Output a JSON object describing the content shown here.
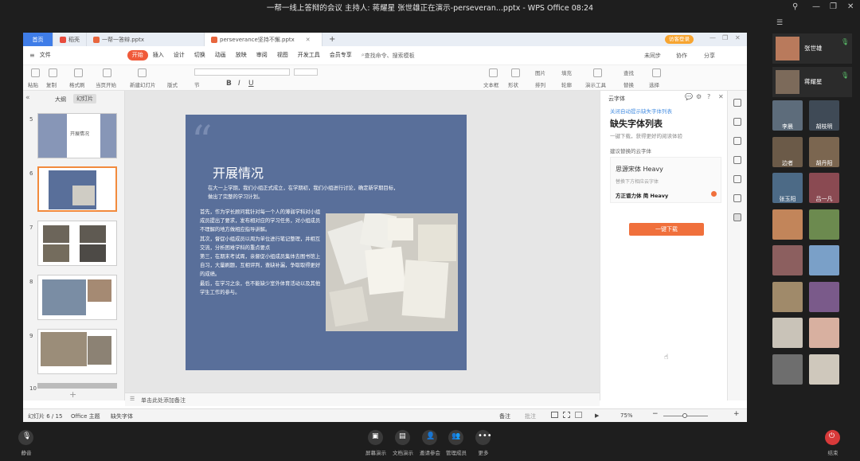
{
  "meeting": {
    "title": "一帮一线上答辩的会议  主持人: 蒋耀星  张世雄正在演示-perseveran...pptx - WPS Office  08:24"
  },
  "wps": {
    "tabs": [
      {
        "label": "首页"
      },
      {
        "label": "稻壳"
      },
      {
        "label": "一帮一答辩.pptx"
      },
      {
        "label": "perseverance坚持不懈.pptx"
      }
    ],
    "login_label": "访客登录",
    "menu": [
      "文件",
      "开始",
      "插入",
      "设计",
      "切换",
      "动画",
      "放映",
      "审阅",
      "视图",
      "开发工具",
      "会员专享"
    ],
    "search_placeholder": "查找命令、搜索模板",
    "right_menu": [
      "未同步",
      "协作",
      "分享"
    ],
    "toolbar_labels": [
      "粘贴",
      "复制",
      "格式刷",
      "当页开始",
      "新建幻灯片",
      "版式",
      "节",
      "文本框",
      "形状",
      "图片",
      "排列",
      "填充",
      "轮廓",
      "演示工具",
      "查找",
      "替换",
      "选择"
    ],
    "pane_tabs": [
      "大纲",
      "幻灯片"
    ],
    "slides": [
      {
        "num": "5",
        "label": "开展情况"
      },
      {
        "num": "6",
        "label": ""
      },
      {
        "num": "7",
        "label": ""
      },
      {
        "num": "8",
        "label": ""
      },
      {
        "num": "9",
        "label": ""
      },
      {
        "num": "10",
        "label": ""
      }
    ],
    "slide": {
      "title": "开展情况",
      "intro": "在大一上学期，我们小组正式成立，在学期初，我们小组进行讨论，确定新学期目标，做出了完整的学习计划。",
      "body": [
        "首先，作为学长顾问我针对每一个人的薄弱学科对小组成员提出了要求，发布相对应的学习任务，对小组成员不理解的地方做相应指导讲解。",
        "其次，督促小组成员以周为单位进行笔记整理，并相互交流，分析困难学科的重点要点",
        "第三，在期末考试周，亲督促小组成员集体去图书馆上自习，大量刷题，互相评判，查缺补漏，争取取得更好的成绩。",
        "最后，在学习之余，也不能缺少室外体育活动以及其他学生工作的参与。"
      ]
    },
    "notes_placeholder": "单击此处添加备注",
    "status": {
      "slide_count": "幻灯片 6 / 15",
      "theme": "Office 主题",
      "missing_font": "缺失字体",
      "notes": "备注",
      "comment": "批注",
      "zoom": "75%"
    },
    "font_panel": {
      "header": "云字体",
      "close_tip": "关闭自动提示缺失字体列表",
      "title": "缺失字体列表",
      "subtitle": "一键下载，获得更好的阅读体验",
      "recommend": "建议替换的云字体",
      "font_name": "思源宋体 Heavy",
      "replace_hint": "替换下方相应云字体",
      "replacement": "方正谱力体 简 Heavy",
      "download_button": "一键下载"
    }
  },
  "participants": {
    "main": [
      {
        "name": "张世雄"
      },
      {
        "name": "蒋耀星"
      }
    ],
    "grid": [
      {
        "name": "李晨"
      },
      {
        "name": "胡枝明"
      },
      {
        "name": "边者"
      },
      {
        "name": "胡丹阳"
      },
      {
        "name": "张玉阳"
      },
      {
        "name": "吕一凡"
      },
      {
        "name": ""
      },
      {
        "name": ""
      },
      {
        "name": ""
      },
      {
        "name": ""
      },
      {
        "name": ""
      },
      {
        "name": ""
      },
      {
        "name": ""
      },
      {
        "name": ""
      },
      {
        "name": ""
      },
      {
        "name": ""
      }
    ]
  },
  "bottom": {
    "mute": "静音",
    "buttons": [
      "屏幕演示",
      "文档演示",
      "邀请参会",
      "管理成员",
      "更多"
    ],
    "end": "结束"
  },
  "colors": {
    "slide_bg": "#596f9a",
    "accent": "#f05a3a",
    "download": "#f0703c",
    "home_tab": "#3f7de8"
  }
}
